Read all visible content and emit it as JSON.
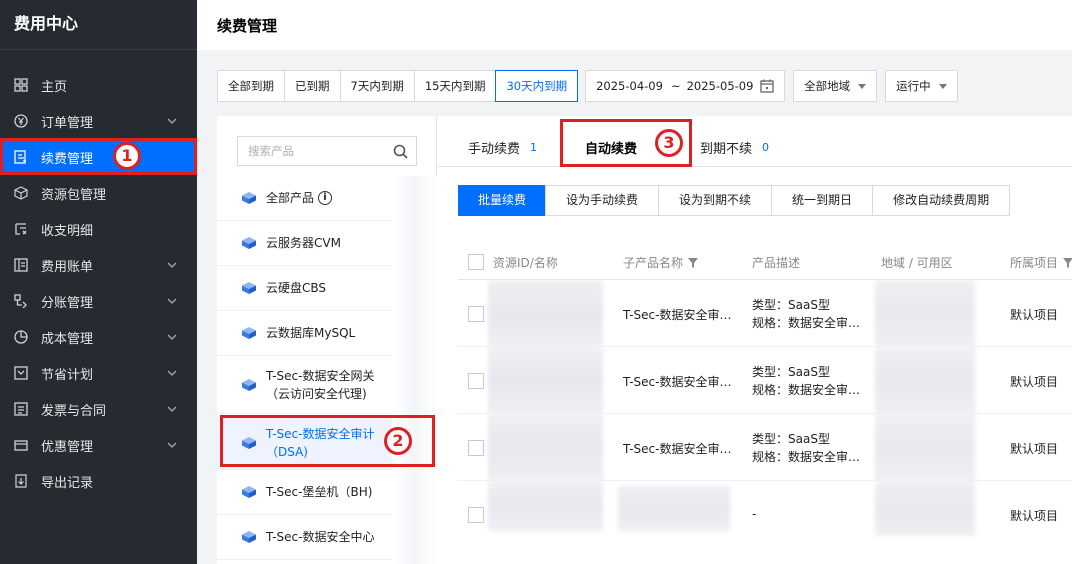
{
  "sidebar": {
    "title": "费用中心",
    "items": [
      {
        "label": "主页",
        "icon": "grid-icon",
        "chevron": false
      },
      {
        "label": "订单管理",
        "icon": "yen-icon",
        "chevron": true
      },
      {
        "label": "续费管理",
        "icon": "renew-icon",
        "chevron": false,
        "active": true
      },
      {
        "label": "资源包管理",
        "icon": "package-icon",
        "chevron": false
      },
      {
        "label": "收支明细",
        "icon": "ledger-icon",
        "chevron": false
      },
      {
        "label": "费用账单",
        "icon": "bill-icon",
        "chevron": true
      },
      {
        "label": "分账管理",
        "icon": "split-icon",
        "chevron": true
      },
      {
        "label": "成本管理",
        "icon": "pie-icon",
        "chevron": true
      },
      {
        "label": "节省计划",
        "icon": "plan-icon",
        "chevron": true
      },
      {
        "label": "发票与合同",
        "icon": "invoice-icon",
        "chevron": true
      },
      {
        "label": "优惠管理",
        "icon": "coupon-icon",
        "chevron": true
      },
      {
        "label": "导出记录",
        "icon": "export-icon",
        "chevron": false
      }
    ]
  },
  "header": {
    "title": "续费管理"
  },
  "filters": {
    "expiry": [
      "全部到期",
      "已到期",
      "7天内到期",
      "15天内到期",
      "30天内到期"
    ],
    "selected": "30天内到期",
    "date_start": "2025-04-09",
    "date_sep": "~",
    "date_end": "2025-05-09",
    "region": "全部地域",
    "status": "运行中"
  },
  "products": {
    "search_placeholder": "搜索产品",
    "items": [
      {
        "label": "全部产品",
        "info": "i"
      },
      {
        "label": "云服务器CVM"
      },
      {
        "label": "云硬盘CBS"
      },
      {
        "label": "云数据库MySQL"
      },
      {
        "label": "T-Sec-数据安全网关",
        "label2": "（云访问安全代理)"
      },
      {
        "label": "T-Sec-数据安全审计",
        "label2": "（DSA)",
        "selected": true
      },
      {
        "label": "T-Sec-堡垒机（BH)"
      },
      {
        "label": "T-Sec-数据安全中心"
      }
    ]
  },
  "tabs": [
    {
      "label": "手动续费",
      "count": "1"
    },
    {
      "label": "自动续费",
      "count": "",
      "active": true
    },
    {
      "label": "到期不续",
      "count": "0"
    }
  ],
  "actions": {
    "primary": "批量续费",
    "buttons": [
      "设为手动续费",
      "设为到期不续",
      "统一到期日",
      "修改自动续费周期"
    ]
  },
  "table": {
    "headers": [
      "资源ID/名称",
      "子产品名称",
      "产品描述",
      "地域 / 可用区",
      "所属项目"
    ],
    "rows": [
      {
        "subproduct": "T-Sec-数据安全审…",
        "desc1": "类型：SaaS型",
        "desc2": "规格：数据安全审…",
        "project": "默认项目"
      },
      {
        "subproduct": "T-Sec-数据安全审…",
        "desc1": "类型：SaaS型",
        "desc2": "规格：数据安全审…",
        "project": "默认项目"
      },
      {
        "subproduct": "T-Sec-数据安全审…",
        "desc1": "类型：SaaS型",
        "desc2": "规格：数据安全审…",
        "project": "默认项目"
      },
      {
        "subproduct": "",
        "desc1": "-",
        "desc2": "",
        "project": "默认项目"
      }
    ]
  },
  "annotations": [
    "1",
    "2",
    "3"
  ],
  "colors": {
    "accent": "#006eff",
    "annotation": "#e02020",
    "sidebar": "#262a31"
  }
}
